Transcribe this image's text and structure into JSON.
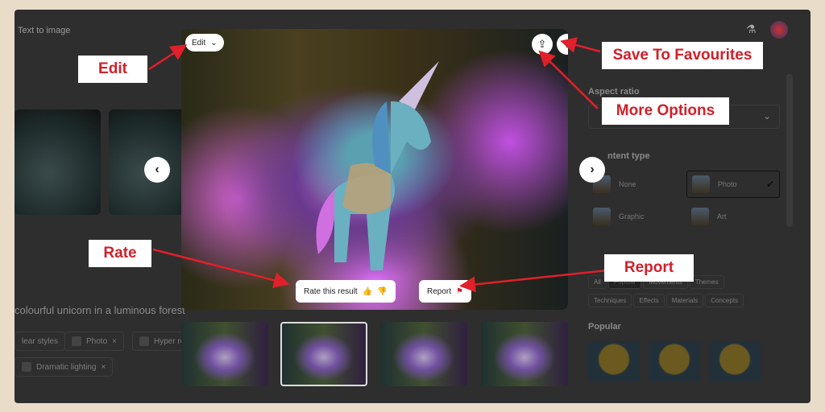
{
  "header": {
    "title": "Text to image"
  },
  "prompt": {
    "text": "colourful unicorn in a luminous forest"
  },
  "chips": [
    {
      "label": "lear styles"
    },
    {
      "label": "Photo",
      "close": "×"
    },
    {
      "label": "Hyper re"
    },
    {
      "label": "Dramatic lighting",
      "close": "×"
    }
  ],
  "right_panel": {
    "aspect_ratio": "Aspect ratio",
    "content_type": "ntent type",
    "content_types": [
      {
        "label": "None"
      },
      {
        "label": "Photo",
        "selected": true
      },
      {
        "label": "Graphic"
      },
      {
        "label": "Art"
      }
    ],
    "style_tags": [
      "All",
      "Popular",
      "Movements",
      "Themes",
      "Techniques",
      "Effects",
      "Materials",
      "Concepts"
    ],
    "selected_tag": "Popular",
    "popular": "Popular"
  },
  "modal": {
    "edit": "Edit",
    "rate": "Rate this result",
    "report": "Report"
  },
  "annotations": {
    "edit": "Edit",
    "save": "Save To Favourites",
    "more": "More Options",
    "rate": "Rate",
    "report": "Report"
  },
  "colors": {
    "annotation_text": "#d0202a",
    "arrow": "#e0202a",
    "background": "#e9dcc9"
  }
}
